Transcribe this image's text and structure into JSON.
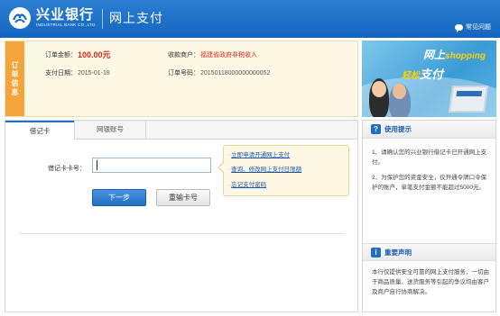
{
  "header": {
    "logo_name": "兴业银行",
    "logo_en": "INDUSTRIAL BANK CO.,LTD.",
    "title": "网上支付",
    "faq_label": "常见问题",
    "brand_color": "#1a6cc6"
  },
  "order": {
    "section_label": "订单信息",
    "amount_label": "订单金额：",
    "amount_value": "100.00元",
    "merchant_label": "收款商户：",
    "merchant_value": "福建省政府非税收入",
    "date_label": "支付日期：",
    "date_value": "2015-01-18",
    "order_no_label": "订单号码：",
    "order_no_value": "20150118000000000052"
  },
  "banner": {
    "line1": "网上",
    "line1_en": "shopping",
    "line2_prefix": "轻松",
    "line2": "支付"
  },
  "tabs": [
    {
      "label": "借记卡",
      "active": true
    },
    {
      "label": "网银账号",
      "active": false
    }
  ],
  "form": {
    "card_label": "借记卡卡号：",
    "card_value": "",
    "next_label": "下一步",
    "reset_label": "重输卡号"
  },
  "tips_links": [
    "立即申请开通网上支付",
    "查询、修改网上支付日限额",
    "忘记支付密码"
  ],
  "side": {
    "usage_title": "使用提示",
    "usage_1": "1、请确认您的兴业银行借记卡已开通网上支付。",
    "usage_2": "2、为保护您的资金安全，仅开通令牌口令保护的账户，单笔支付金额不能超过5000元。",
    "notice_title": "重要声明",
    "notice_text": "本行仅提供安全可靠的网上支付服务，一切由于商品质量、送货服务等引起的争议均由客户及商户自行协商解决。"
  }
}
